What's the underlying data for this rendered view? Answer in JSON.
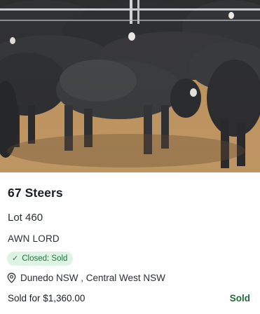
{
  "listing": {
    "photo_alt": "cattle-photo",
    "title": "67 Steers",
    "lot": "Lot 460",
    "vendor": "AWN LORD",
    "status_badge": "Closed: Sold",
    "location": "Dunedo NSW , Central West NSW",
    "price_text": "Sold for $1,360.00",
    "sale_status": "Sold"
  },
  "colors": {
    "badge_bg": "#ddf3e4",
    "badge_text": "#1c7a3e",
    "sold_text": "#1f6b3c"
  },
  "icons": {
    "badge_icon": "check-icon",
    "location_icon": "map-pin-icon"
  }
}
